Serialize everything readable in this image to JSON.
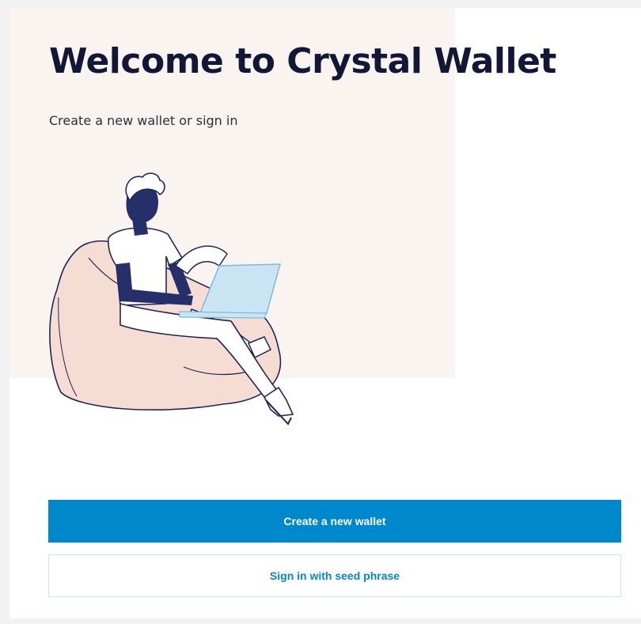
{
  "welcome": {
    "title": "Welcome to Crystal Wallet",
    "subtitle": "Create a new wallet or sign in",
    "illustration": "person-on-beanbag-with-laptop",
    "background_color": "#faf4f1"
  },
  "actions": {
    "create_wallet_label": "Create a new wallet",
    "sign_in_label": "Sign in with seed phrase"
  },
  "colors": {
    "accent": "#0088cc",
    "title": "#121737",
    "beanbag": "#f6ddd3",
    "laptop": "#c9e5f3",
    "outline": "#202755"
  }
}
